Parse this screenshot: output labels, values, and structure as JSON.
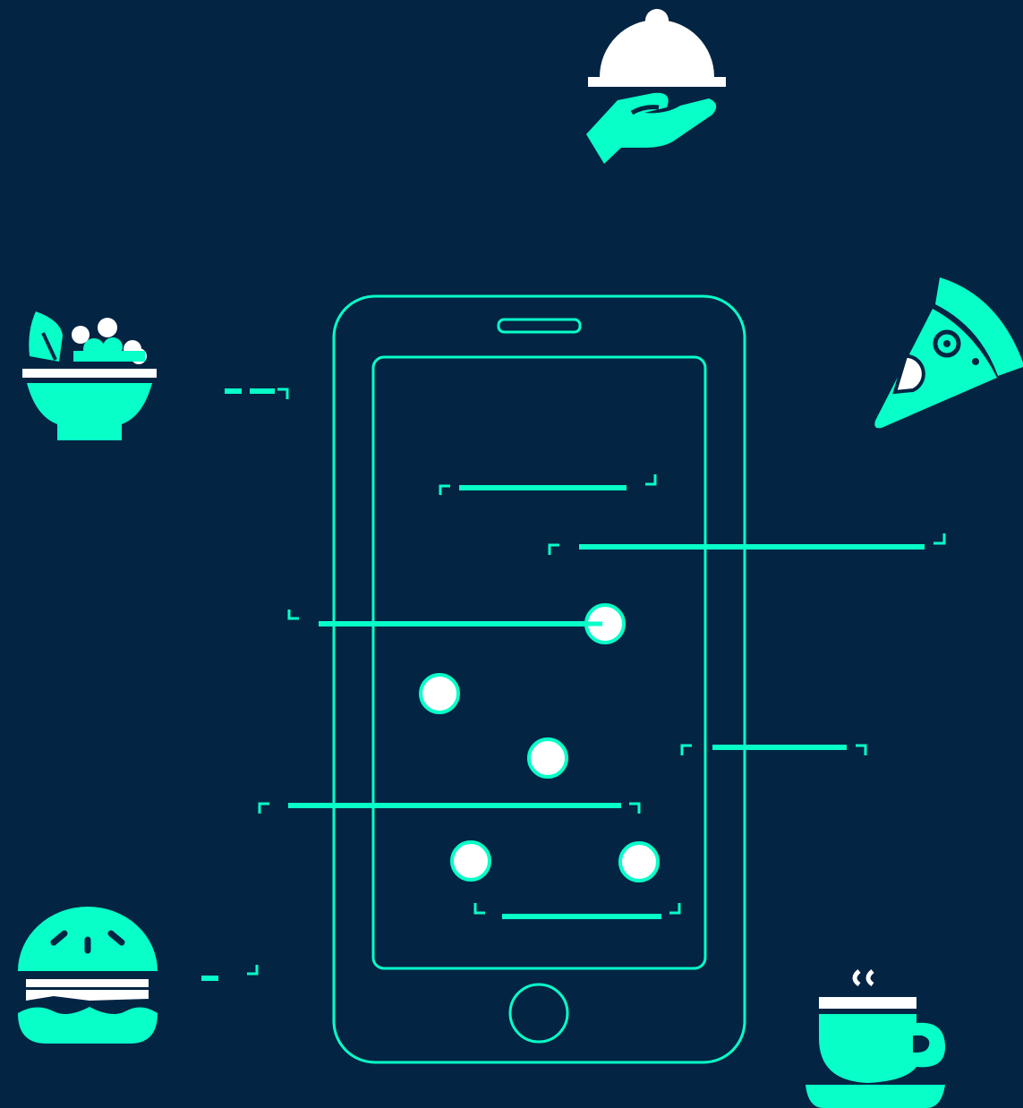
{
  "colors": {
    "background": "#032543",
    "accent": "#08ffc8",
    "white": "#ffffff"
  },
  "icons": [
    "cloche-serving-icon",
    "salad-bowl-icon",
    "pizza-slice-icon",
    "burger-icon",
    "coffee-cup-icon"
  ],
  "phone": {
    "screen_content": "placeholder-lines-and-dots"
  }
}
